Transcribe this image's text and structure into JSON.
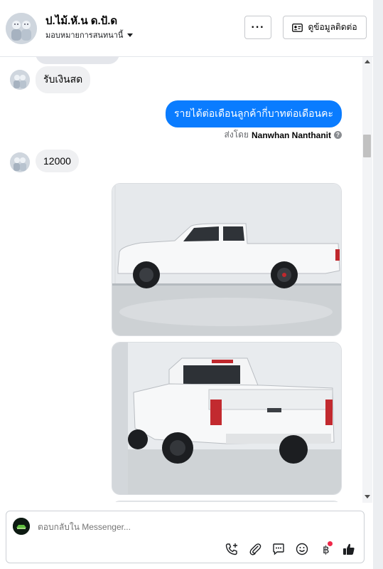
{
  "header": {
    "name": "ป.ไม้.หั.น ด.ปั.ด",
    "assignee_label": "มอบหมายการสนทนานี้",
    "more_label": "···",
    "view_contact_label": "ดูข้อมูลติดต่อ"
  },
  "messages": {
    "incoming_1": "รับเงินสด",
    "outgoing_1": "รายได้ต่อเดือนลูกค้ากี่บาทต่อเดือนคะ",
    "sent_by_prefix": "ส่งโดย",
    "sent_by_name": "Nanwhan Nanthanit",
    "incoming_2": "12000"
  },
  "composer": {
    "placeholder": "ตอบกลับใน Messenger..."
  },
  "colors": {
    "accent_blue": "#0a7cff",
    "incoming_bubble": "#eff0f2",
    "notification_dot": "#f02849"
  },
  "icons": [
    "more-icon",
    "contact-card-icon",
    "dropdown-caret-icon",
    "help-icon",
    "call-add-icon",
    "attach-icon",
    "saved-replies-icon",
    "emoji-icon",
    "baht-payment-icon",
    "like-icon"
  ]
}
